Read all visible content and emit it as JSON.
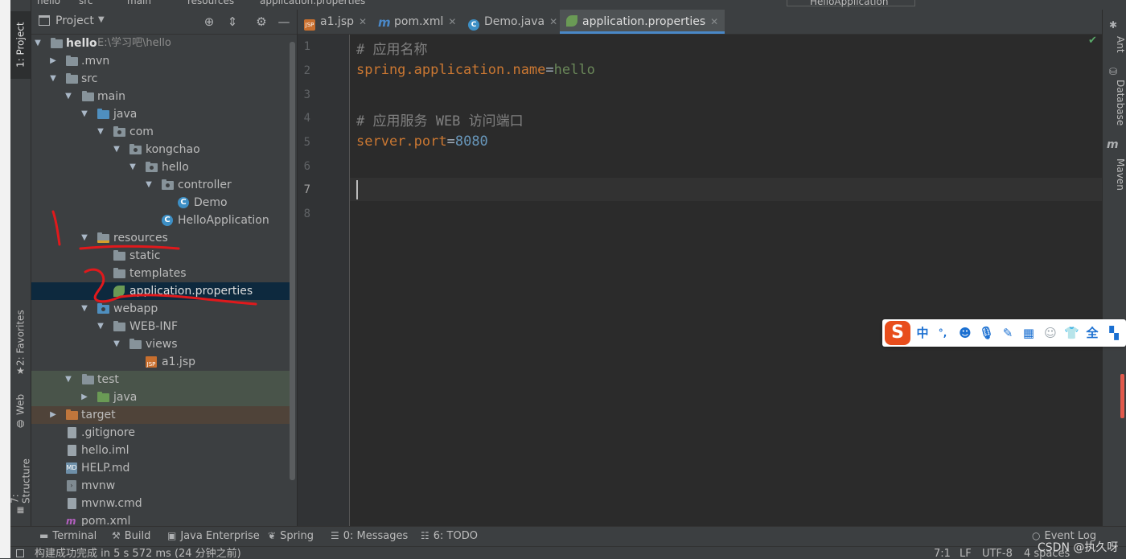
{
  "breadcrumb": {
    "items": [
      "hello",
      "src",
      "main",
      "resources",
      "application.properties"
    ]
  },
  "run_config": "HelloApplication",
  "left_toolbar": {
    "project_tab": "1: Project",
    "favorites_tab": "2: Favorites",
    "web_tab": "Web",
    "structure_tab": "7: Structure"
  },
  "project_panel": {
    "title": "Project",
    "tree": [
      {
        "label": "hello",
        "path": "E:\\学习吧\\hello"
      },
      {
        "label": ".mvn"
      },
      {
        "label": "src"
      },
      {
        "label": "main"
      },
      {
        "label": "java"
      },
      {
        "label": "com"
      },
      {
        "label": "kongchao"
      },
      {
        "label": "hello"
      },
      {
        "label": "controller"
      },
      {
        "label": "Demo"
      },
      {
        "label": "HelloApplication"
      },
      {
        "label": "resources"
      },
      {
        "label": "static"
      },
      {
        "label": "templates"
      },
      {
        "label": "application.properties"
      },
      {
        "label": "webapp"
      },
      {
        "label": "WEB-INF"
      },
      {
        "label": "views"
      },
      {
        "label": "a1.jsp"
      },
      {
        "label": "test"
      },
      {
        "label": "java"
      },
      {
        "label": "target"
      },
      {
        "label": ".gitignore"
      },
      {
        "label": "hello.iml"
      },
      {
        "label": "HELP.md"
      },
      {
        "label": "mvnw"
      },
      {
        "label": "mvnw.cmd"
      },
      {
        "label": "pom.xml"
      }
    ]
  },
  "editor_tabs": [
    {
      "label": "a1.jsp",
      "icon": "jsp-icon",
      "active": false
    },
    {
      "label": "pom.xml",
      "icon": "maven-icon",
      "active": false
    },
    {
      "label": "Demo.java",
      "icon": "class-icon",
      "active": false
    },
    {
      "label": "application.properties",
      "icon": "spring-properties-icon",
      "active": true
    }
  ],
  "editor": {
    "line_numbers": [
      "1",
      "2",
      "3",
      "4",
      "5",
      "6",
      "7",
      "8"
    ],
    "current_line": "7",
    "lines": {
      "l1_comment": "# 应用名称",
      "l2_key": "spring.application.name",
      "l2_eq": "=",
      "l2_val": "hello",
      "l4_comment": "# 应用服务 WEB 访问端口",
      "l5_key": "server.port",
      "l5_eq": "=",
      "l5_val": "8080"
    }
  },
  "right_toolbar": {
    "ant": "Ant",
    "database": "Database",
    "maven": "Maven"
  },
  "bottom_tools": [
    {
      "label": "Terminal",
      "icon": "terminal-icon"
    },
    {
      "label": "Build",
      "icon": "hammer-icon"
    },
    {
      "label": "Java Enterprise",
      "icon": "java-enterprise-icon"
    },
    {
      "label": "Spring",
      "icon": "spring-leaf-icon"
    },
    {
      "label": "0: Messages",
      "icon": "messages-icon"
    },
    {
      "label": "6: TODO",
      "icon": "todo-icon"
    },
    {
      "label": "Event Log",
      "icon": "event-log-icon"
    }
  ],
  "status_bar": {
    "message": "构建成功完成 in 5 s 572 ms (24 分钟之前)",
    "position": "7:1",
    "line_sep": "LF",
    "encoding": "UTF-8",
    "indent": "4 spaces"
  },
  "ime_toolbar": {
    "logo": "S",
    "mode": "中",
    "punct": "°,"
  },
  "watermark": "CSDN @执久呀",
  "colors": {
    "accent": "#4a88c7",
    "keyword": "#cc7832",
    "value": "#6a8759",
    "number": "#6897bb",
    "annotation": "#e0191c"
  }
}
